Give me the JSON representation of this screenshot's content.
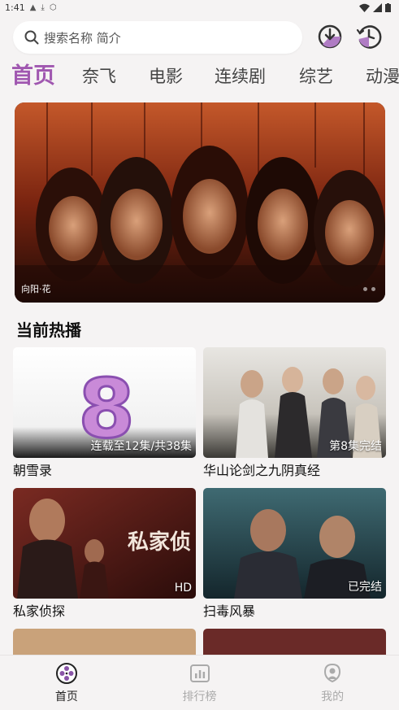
{
  "status": {
    "time": "1:41"
  },
  "search": {
    "placeholder": "搜索名称 简介"
  },
  "tabs": [
    {
      "label": "首页",
      "active": true
    },
    {
      "label": "奈飞"
    },
    {
      "label": "电影"
    },
    {
      "label": "连续剧"
    },
    {
      "label": "综艺"
    },
    {
      "label": "动漫"
    }
  ],
  "banner": {
    "caption": "向阳·花",
    "slide_index": 1,
    "slide_count": 2
  },
  "hot": {
    "title": "当前热播",
    "items": [
      {
        "title": "朝雪录",
        "badge": "连载至12集/共38集",
        "art_text": "8"
      },
      {
        "title": "华山论剑之九阴真经",
        "badge": "第8集完结"
      },
      {
        "title": "私家侦探",
        "badge": "HD",
        "art_text": "私家侦"
      },
      {
        "title": "扫毒风暴",
        "badge": "已完结"
      }
    ]
  },
  "nav": [
    {
      "label": "首页",
      "icon": "film-reel-icon",
      "active": true
    },
    {
      "label": "排行榜",
      "icon": "chart-icon"
    },
    {
      "label": "我的",
      "icon": "profile-icon"
    }
  ],
  "colors": {
    "accent": "#a057b0",
    "background": "#f5f3f3"
  }
}
